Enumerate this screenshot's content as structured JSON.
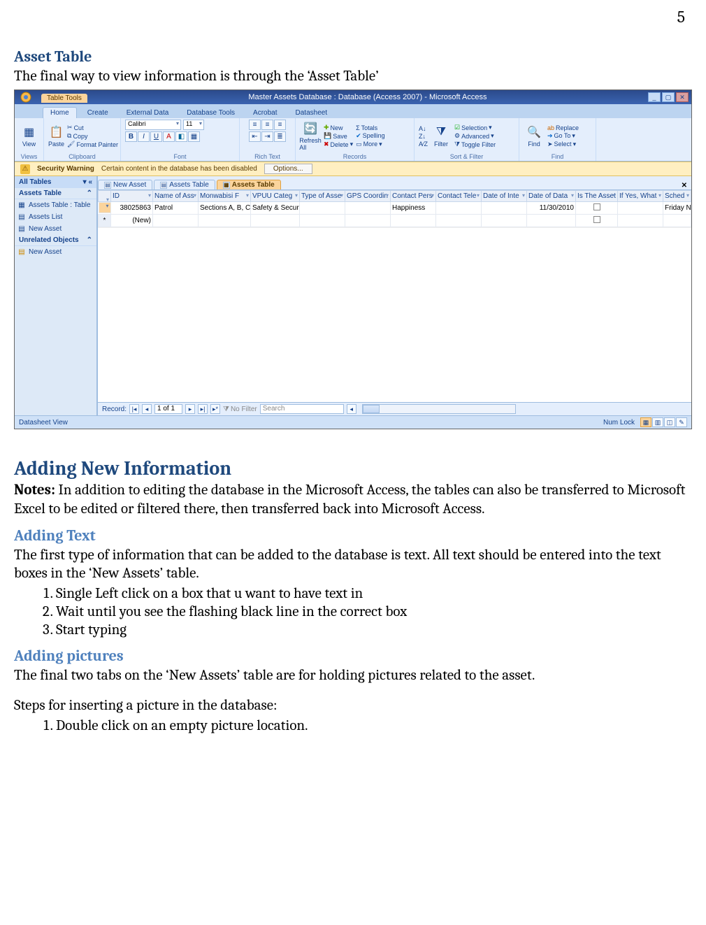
{
  "page_number": "5",
  "doc": {
    "h_asset_table": "Asset Table",
    "p_asset_table": "The final way to view information is through the ‘Asset Table’",
    "h_adding": "Adding New Information",
    "notes_label": "Notes:",
    "notes_text": " In addition to editing the database in the Microsoft Access, the tables can also be transferred to Microsoft Excel to be edited or filtered there, then transferred back into Microsoft Access.",
    "h_adding_text": "Adding Text",
    "p_adding_text": "The first type of information that can be added to the database is text. All text should be entered into the text boxes in the ‘New Assets’ table.",
    "steps_text": [
      "Single Left click on a box that u want to have text in",
      "Wait until you see the flashing black line in the correct box",
      "Start typing"
    ],
    "h_adding_pics": "Adding pictures",
    "p_adding_pics": "The final two tabs on the ‘New Assets’ table are for holding pictures related to the asset.",
    "p_pic_steps_intro": "Steps for inserting a picture in the database:",
    "steps_pics": [
      "Double click on an empty picture location."
    ]
  },
  "access": {
    "table_tools": "Table Tools",
    "window_title": "Master Assets Database : Database (Access 2007) - Microsoft Access",
    "ribbon_tabs": [
      "Home",
      "Create",
      "External Data",
      "Database Tools",
      "Acrobat",
      "Datasheet"
    ],
    "groups": {
      "views": {
        "label": "Views",
        "view_btn": "View"
      },
      "clipboard": {
        "label": "Clipboard",
        "paste": "Paste",
        "cut": "Cut",
        "copy": "Copy",
        "fp": "Format Painter"
      },
      "font": {
        "label": "Font",
        "name": "Calibri",
        "size": "11"
      },
      "richtext": {
        "label": "Rich Text"
      },
      "records": {
        "label": "Records",
        "refresh": "Refresh All",
        "new": "New",
        "save": "Save",
        "delete": "Delete",
        "totals": "Totals",
        "spelling": "Spelling",
        "more": "More"
      },
      "sortfilter": {
        "label": "Sort & Filter",
        "filter": "Filter",
        "selection": "Selection",
        "advanced": "Advanced",
        "toggle": "Toggle Filter"
      },
      "find": {
        "label": "Find",
        "find": "Find",
        "replace": "Replace",
        "goto": "Go To",
        "select": "Select"
      }
    },
    "security": {
      "title": "Security Warning",
      "msg": "Certain content in the database has been disabled",
      "options": "Options..."
    },
    "nav": {
      "header": "All Tables",
      "cat1": "Assets Table",
      "items1": [
        "Assets Table : Table",
        "Assets List",
        "New Asset"
      ],
      "cat2": "Unrelated Objects",
      "items2": [
        "New Asset"
      ]
    },
    "tabs": [
      {
        "label": "New Asset"
      },
      {
        "label": "Assets Table"
      },
      {
        "label": "Assets Table"
      }
    ],
    "columns": [
      "ID",
      "Name of Ass",
      "Monwabisi F",
      "VPUU Categ",
      "Type of Asse",
      "GPS Coordin",
      "Contact Pers",
      "Contact Tele",
      "Date of Inte",
      "Date of Data",
      "Is The Asset",
      "If Yes, What",
      "Sched"
    ],
    "row1": {
      "id": "38025863",
      "name": "Patrol",
      "mon": "Sections A, B, C",
      "vpuu": "Safety & Securi",
      "type": "",
      "gps": "",
      "contact": "Happiness",
      "tel": "",
      "interv": "",
      "data": "11/30/2010",
      "isasset": "",
      "ifyes": "",
      "sched": "Friday N"
    },
    "row_new": "(New)",
    "recnav": {
      "label": "Record:",
      "pos": "1 of 1",
      "nofilter": "No Filter",
      "search": "Search"
    },
    "status": {
      "left": "Datasheet View",
      "numlock": "Num Lock"
    }
  }
}
